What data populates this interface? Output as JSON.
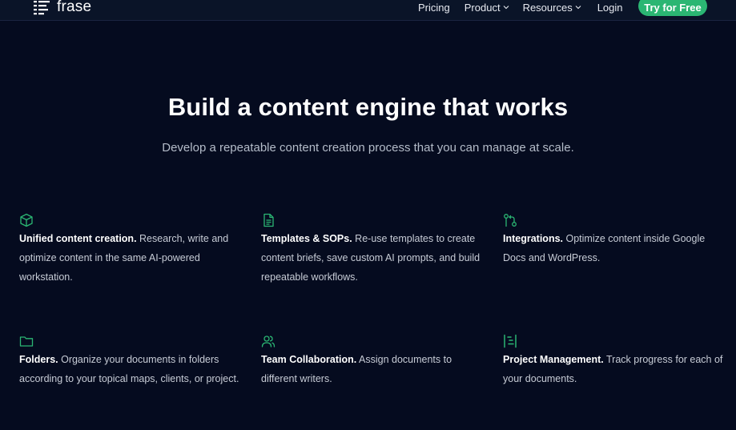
{
  "brand": {
    "name": "frase",
    "accent": "#2bb673",
    "background": "#050b1f"
  },
  "nav": {
    "links": [
      {
        "label": "Pricing",
        "has_dropdown": false
      },
      {
        "label": "Product",
        "has_dropdown": true
      },
      {
        "label": "Resources",
        "has_dropdown": true
      },
      {
        "label": "Login",
        "has_dropdown": false
      }
    ],
    "cta_label": "Try for Free"
  },
  "hero": {
    "title": "Build a content engine that works",
    "subtitle": "Develop a repeatable content creation process that you can manage at scale."
  },
  "features": [
    {
      "icon": "cube-icon",
      "title": "Unified content creation.",
      "text": " Research, write and optimize content in the same AI-powered workstation."
    },
    {
      "icon": "document-icon",
      "title": "Templates & SOPs.",
      "text": " Re-use templates to create content briefs, save custom AI prompts, and build repeatable workflows."
    },
    {
      "icon": "integration-icon",
      "title": "Integrations.",
      "text": " Optimize content inside Google Docs and WordPress."
    },
    {
      "icon": "folder-icon",
      "title": "Folders.",
      "text": " Organize your documents in folders according to your topical maps, clients, or project."
    },
    {
      "icon": "users-icon",
      "title": "Team Collaboration.",
      "text": " Assign documents to different writers."
    },
    {
      "icon": "kanban-icon",
      "title": "Project Management.",
      "text": " Track progress for each of your documents."
    }
  ]
}
